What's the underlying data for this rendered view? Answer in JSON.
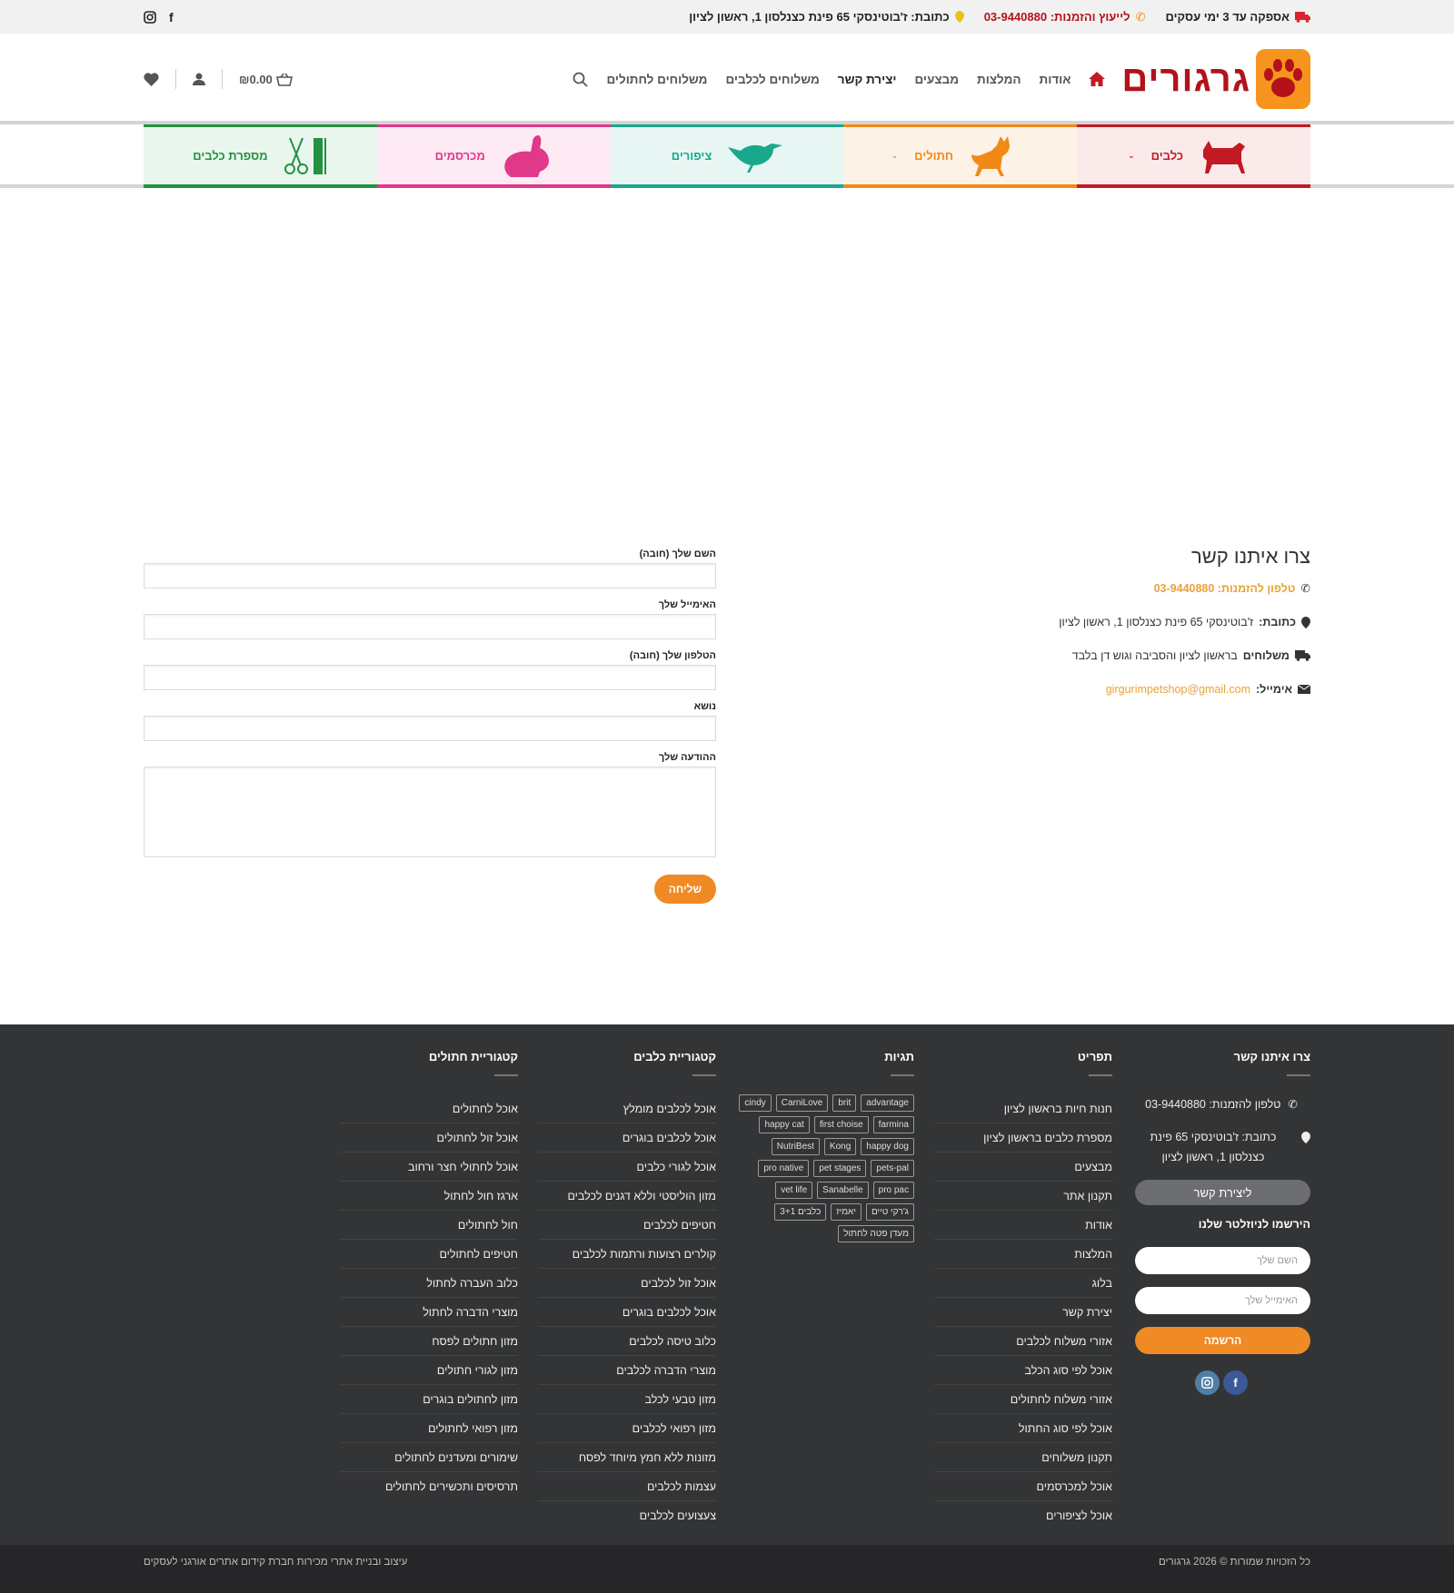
{
  "topbar": {
    "delivery": "אספקה עד 3 ימי עסקים",
    "consult": "לייעוץ והזמנות: 03-9440880",
    "address": "כתובת: ז'בוטינסקי 65 פינת כצנלסון 1, ראשון לציון"
  },
  "header": {
    "logo_text": "גרגורים",
    "nav": [
      "אודות",
      "המלצות",
      "מבצעים",
      "יצירת קשר",
      "משלוחים לכלבים",
      "משלוחים לחתולים"
    ],
    "cart_total": "₪0.00"
  },
  "categories": [
    {
      "label": "כלבים"
    },
    {
      "label": "חתולים"
    },
    {
      "label": "ציפורים"
    },
    {
      "label": "מכרסמים"
    },
    {
      "label": "מספרת כלבים"
    }
  ],
  "contact": {
    "title": "צרו איתנו קשר",
    "phone": "טלפון להזמנות: 03-9440880",
    "address_label": "כתובת:",
    "address": "ז'בוטינסקי 65 פינת כצנלסון 1, ראשון לציון",
    "shipping_label": "משלוחים",
    "shipping": "בראשון לציון והסביבה וגוש דן בלבד",
    "email_label": "אימייל:",
    "email": "girgurimpetshop@gmail.com"
  },
  "form": {
    "name_label": "השם שלך (חובה)",
    "email_label": "האימייל שלך",
    "phone_label": "הטלפון שלך (חובה)",
    "subject_label": "נושא",
    "message_label": "ההודעה שלך",
    "submit": "שליחה"
  },
  "footer": {
    "contact_title": "צרו איתנו קשר",
    "phone": "טלפון להזמנות: 03-9440880",
    "address": "כתובת: ז'בוטינסקי 65 פינת כצנלסון 1, ראשון לציון",
    "contact_btn": "ליצירת קשר",
    "newsletter_title": "הירשמו לניוזלטר שלנו",
    "nl_name_ph": "השם שלך",
    "nl_email_ph": "האימייל שלך",
    "nl_submit": "הרשמה",
    "menu_title": "תפריט",
    "menu": [
      "חנות חיות בראשון לציון",
      "מספרת כלבים בראשון לציון",
      "מבצעים",
      "תקנון אתר",
      "אודות",
      "המלצות",
      "בלוג",
      "יצירת קשר",
      "אזורי משלוח לכלבים",
      "אוכל לפי סוג הכלב",
      "אזורי משלוח לחתולים",
      "אוכל לפי סוג החתול",
      "תקנון משלוחים",
      "אוכל למכרסמים",
      "אוכל לציפורים"
    ],
    "tags_title": "תגיות",
    "tags": [
      "advantage",
      "brit",
      "CarniLove",
      "cindy",
      "farmina",
      "first choise",
      "happy cat",
      "happy dog",
      "Kong",
      "NutriBest",
      "pets-pal",
      "pet stages",
      "pro native",
      "pro pac",
      "Sanabelle",
      "vet life",
      "ג'רקי טיים",
      "יאמיז",
      "כלבים 3+1",
      "מעדן פטה לחתול"
    ],
    "dogcat_title": "קטגוריית כלבים",
    "dogcat": [
      "אוכל לכלבים מומלץ",
      "אוכל לכלבים בוגרים",
      "אוכל לגורי כלבים",
      "מזון הוליסטי וללא דגנים לכלבים",
      "חטיפים לכלבים",
      "קולרים רצועות ורתמות לכלבים",
      "אוכל זול לכלבים",
      "אוכל לכלבים בוגרים",
      "כלוב טיסה לכלבים",
      "מוצרי הדברה לכלבים",
      "מזון טבעי לכלב",
      "מזון רפואי לכלבים",
      "מזונות ללא חמץ מיוחד לפסח",
      "עצמות לכלבים",
      "צעצועים לכלבים"
    ],
    "catcat_title": "קטגוריית חתולים",
    "catcat": [
      "אוכל לחתולים",
      "אוכל זול לחתולים",
      "אוכל לחתולי חצר ורחוב",
      "ארגז חול לחתול",
      "חול לחתולים",
      "חטיפים לחתולים",
      "כלוב העברה לחתול",
      "מוצרי הדברה לחתול",
      "מזון חתולים לפסח",
      "מזון לגורי חתולים",
      "מזון לחתולים בוגרים",
      "מזון רפואי לחתולים",
      "שימורים ומעדנים לחתולים",
      "תרסיסים ותכשירים לחתולים"
    ]
  },
  "bottom": {
    "copyright": "כל הזכויות שמורות © 2026 גרגורים",
    "credit": "עיצוב ובניית אתרי מכירות חברת קידום אתרים אורגני לעסקים"
  },
  "colors": {
    "brand": "#b3121a",
    "accent": "#f08a24",
    "footer": "#333436"
  }
}
